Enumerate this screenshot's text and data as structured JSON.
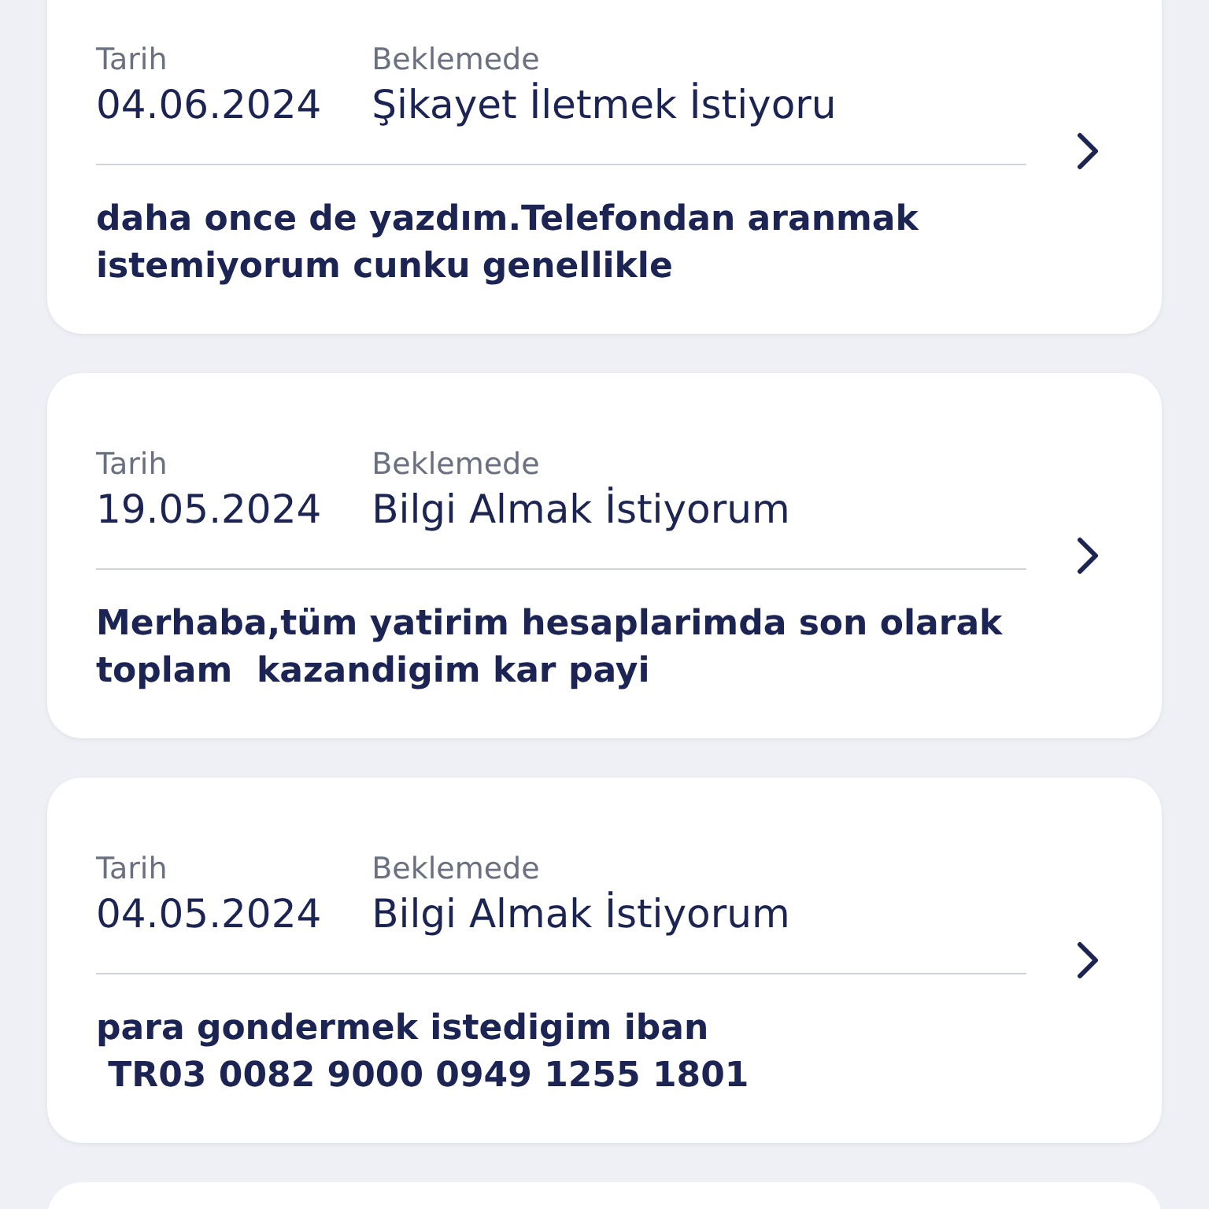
{
  "requests": [
    {
      "date_label": "Tarih",
      "date": "04.06.2024",
      "status": "Beklemede",
      "subject": "Şikayet İletmek İstiyoru",
      "message": "daha once de yazdım.Telefondan aranmak istemiyorum cunku genellikle"
    },
    {
      "date_label": "Tarih",
      "date": "19.05.2024",
      "status": "Beklemede",
      "subject": "Bilgi Almak İstiyorum",
      "message": "Merhaba,tüm yatirim hesaplarimda son olarak  toplam  kazandigim kar payi"
    },
    {
      "date_label": "Tarih",
      "date": "04.05.2024",
      "status": "Beklemede",
      "subject": "Bilgi Almak İstiyorum",
      "message": "para gondermek istedigim iban\n TR03 0082 9000 0949 1255 1801"
    }
  ]
}
